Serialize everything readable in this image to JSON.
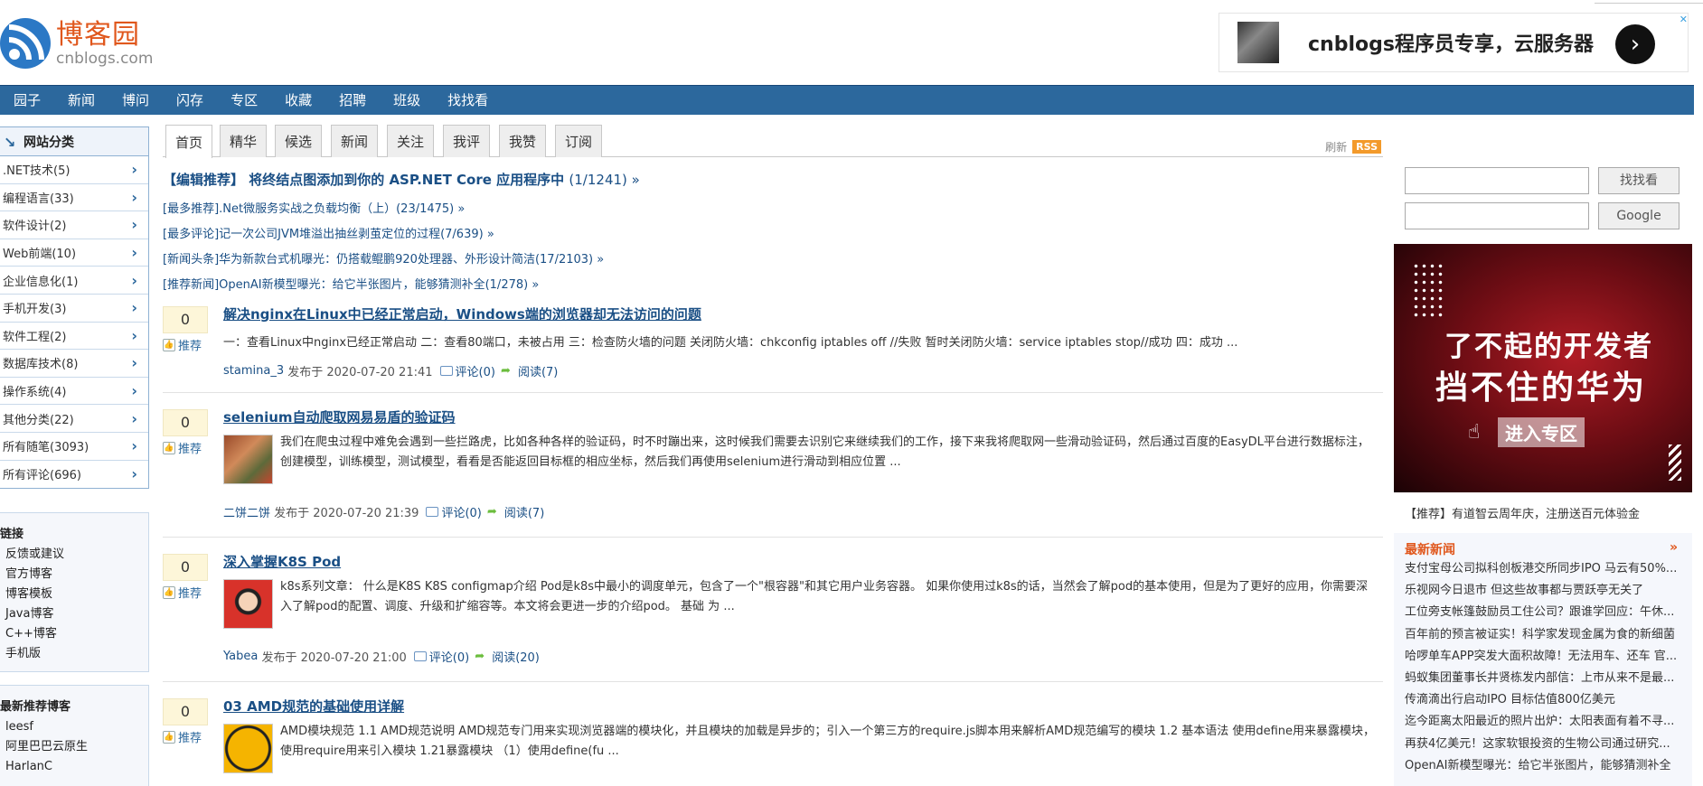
{
  "header": {
    "logo_cn": "博客园",
    "logo_en": "cnblogs.com",
    "ad_title": "cnblogs程序员专享，云服务器",
    "ad_close": "✕",
    "ad_arrow": "›"
  },
  "nav": [
    "园子",
    "新闻",
    "博问",
    "闪存",
    "专区",
    "收藏",
    "招聘",
    "班级",
    "找找看"
  ],
  "sidebar": {
    "category_title": "网站分类",
    "categories": [
      ".NET技术(5)",
      "编程语言(33)",
      "软件设计(2)",
      "Web前端(10)",
      "企业信息化(1)",
      "手机开发(3)",
      "软件工程(2)",
      "数据库技术(8)",
      "操作系统(4)",
      "其他分类(22)",
      "所有随笔(3093)",
      "所有评论(696)"
    ],
    "links_title": "链接",
    "links": [
      "反馈或建议",
      "官方博客",
      "博客模板",
      "Java博客",
      "C++博客",
      "手机版"
    ],
    "recommend_title": "最新推荐博客",
    "recommend": [
      "leesf",
      "阿里巴巴云原生",
      "HarlanC"
    ]
  },
  "tabs": [
    "首页",
    "精华",
    "候选",
    "新闻",
    "关注",
    "我评",
    "我赞",
    "订阅"
  ],
  "refresh_label": "刷新",
  "rss_label": "RSS",
  "headline": {
    "text": "【编辑推荐】 将终结点图添加到你的 ASP.NET Core 应用程序中",
    "count": "(1/1241) »"
  },
  "sub_headlines": [
    "[最多推荐].Net微服务实战之负载均衡（上）(23/1475) »",
    "[最多评论]记一次公司JVM堆溢出抽丝剥茧定位的过程(7/639) »",
    "[新闻头条]华为新款台式机曝光：仍搭载鲲鹏920处理器、外形设计简洁(17/2103) »",
    "[推荐新闻]OpenAI新模型曝光：给它半张图片，能够猜测补全(1/278) »"
  ],
  "posts": [
    {
      "votes": "0",
      "vote_label": "推荐",
      "title": "解决nginx在Linux中已经正常启动，Windows端的浏览器却无法访问的问题",
      "summary": "一：查看Linux中nginx已经正常启动 二：查看80端口，未被占用 三：检查防火墙的问题 关闭防火墙：chkconfig iptables off //失败 暂时关闭防火墙：service iptables stop//成功 四：成功 ...",
      "author": "stamina_3",
      "posted": "发布于 2020-07-20 21:41",
      "comments": "评论(0)",
      "reads": "阅读(7)"
    },
    {
      "votes": "0",
      "vote_label": "推荐",
      "title": "selenium自动爬取网易易盾的验证码",
      "summary": "我们在爬虫过程中难免会遇到一些拦路虎，比如各种各样的验证码，时不时蹦出来，这时候我们需要去识别它来继续我们的工作，接下来我将爬取网一些滑动验证码，然后通过百度的EasyDL平台进行数据标注，创建模型，训练模型，测试模型，看看是否能返回目标框的相应坐标，然后我们再使用selenium进行滑动到相应位置 ...",
      "author": "二饼二饼",
      "posted": "发布于 2020-07-20 21:39",
      "comments": "评论(0)",
      "reads": "阅读(7)"
    },
    {
      "votes": "0",
      "vote_label": "推荐",
      "title": "深入掌握K8S Pod",
      "summary": "k8s系列文章： 什么是K8S K8S configmap介绍 Pod是k8s中最小的调度单元，包含了一个\"根容器\"和其它用户业务容器。 如果你使用过k8s的话，当然会了解pod的基本使用，但是为了更好的应用，你需要深入了解pod的配置、调度、升级和扩缩容等。本文将会更进一步的介绍pod。 基础 为 ...",
      "author": "Yabea",
      "posted": "发布于 2020-07-20 21:00",
      "comments": "评论(0)",
      "reads": "阅读(20)"
    },
    {
      "votes": "0",
      "vote_label": "推荐",
      "title": "03 AMD规范的基础使用详解",
      "summary": "AMD模块规范 1.1 AMD规范说明 AMD规范专门用来实现浏览器端的模块化，并且模块的加载是异步的；引入一个第三方的require.js脚本用来解析AMD规范编写的模块 1.2 基本语法 使用define用来暴露模块，使用require用来引入模块 1.21暴露模块 （1）使用define(fu ..."
    }
  ],
  "right": {
    "search_button": "找找看",
    "google_button": "Google",
    "ad_line1": "了不起的开发者",
    "ad_line2": "挡不住的华为",
    "ad_enter": "进入专区",
    "recommend_text": "【推荐】有道智云周年庆，注册送百元体验金",
    "news_title": "最新新闻",
    "news_more": "»",
    "news": [
      "支付宝母公司拟科创板港交所同步IPO 马云有50%...",
      "乐视网今日退市 但这些故事都与贾跃亭无关了",
      "工位旁支帐篷鼓励员工住公司？跟谁学回应：午休...",
      "百年前的预言被证实！科学家发现金属为食的新细菌",
      "哈啰单车APP突发大面积故障！无法用车、还车 官...",
      "蚂蚁集团董事长井贤栋发内部信：上市从来不是最...",
      "传滴滴出行启动IPO 目标估值800亿美元",
      "迄今距离太阳最近的照片出炉：太阳表面有着不寻...",
      "再获4亿美元！这家软银投资的生物公司通过研究...",
      "OpenAI新模型曝光：给它半张图片，能够猜测补全"
    ]
  },
  "colors": {
    "nav_bg": "#2c689d",
    "link": "#1a4f85",
    "logo_orange": "#e0571c",
    "news_title": "#e0571c",
    "vote_bg": "#fdf6d9"
  }
}
